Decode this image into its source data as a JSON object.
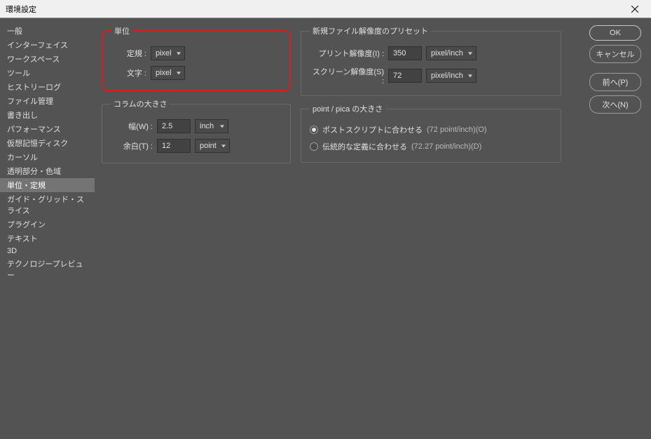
{
  "title": "環境設定",
  "sidebar": {
    "items": [
      "一般",
      "インターフェイス",
      "ワークスペース",
      "ツール",
      "ヒストリーログ",
      "ファイル管理",
      "書き出し",
      "パフォーマンス",
      "仮想記憶ディスク",
      "カーソル",
      "透明部分・色域",
      "単位・定規",
      "ガイド・グリッド・スライス",
      "プラグイン",
      "テキスト",
      "3D",
      "テクノロジープレビュー"
    ],
    "selected_index": 11
  },
  "units": {
    "legend": "単位",
    "ruler_label": "定規 :",
    "ruler_value": "pixel",
    "type_label": "文字 :",
    "type_value": "pixel"
  },
  "column": {
    "legend": "コラムの大きさ",
    "width_label": "幅(W) :",
    "width_value": "2.5",
    "width_unit": "inch",
    "margin_label": "余白(T) :",
    "margin_value": "12",
    "margin_unit": "point"
  },
  "preset": {
    "legend": "新規ファイル解像度のプリセット",
    "print_label": "プリント解像度(I) :",
    "print_value": "350",
    "print_unit": "pixel/inch",
    "screen_label": "スクリーン解像度(S) :",
    "screen_value": "72",
    "screen_unit": "pixel/inch"
  },
  "pica": {
    "legend": "point / pica の大きさ",
    "opt1_label": "ポストスクリプトに合わせる",
    "opt1_suffix": "(72 point/inch)(O)",
    "opt2_label": "伝統的な定義に合わせる",
    "opt2_suffix": "(72.27 point/inch)(D)",
    "selected": 0
  },
  "buttons": {
    "ok": "OK",
    "cancel": "キャンセル",
    "prev": "前へ(P)",
    "next": "次へ(N)"
  }
}
